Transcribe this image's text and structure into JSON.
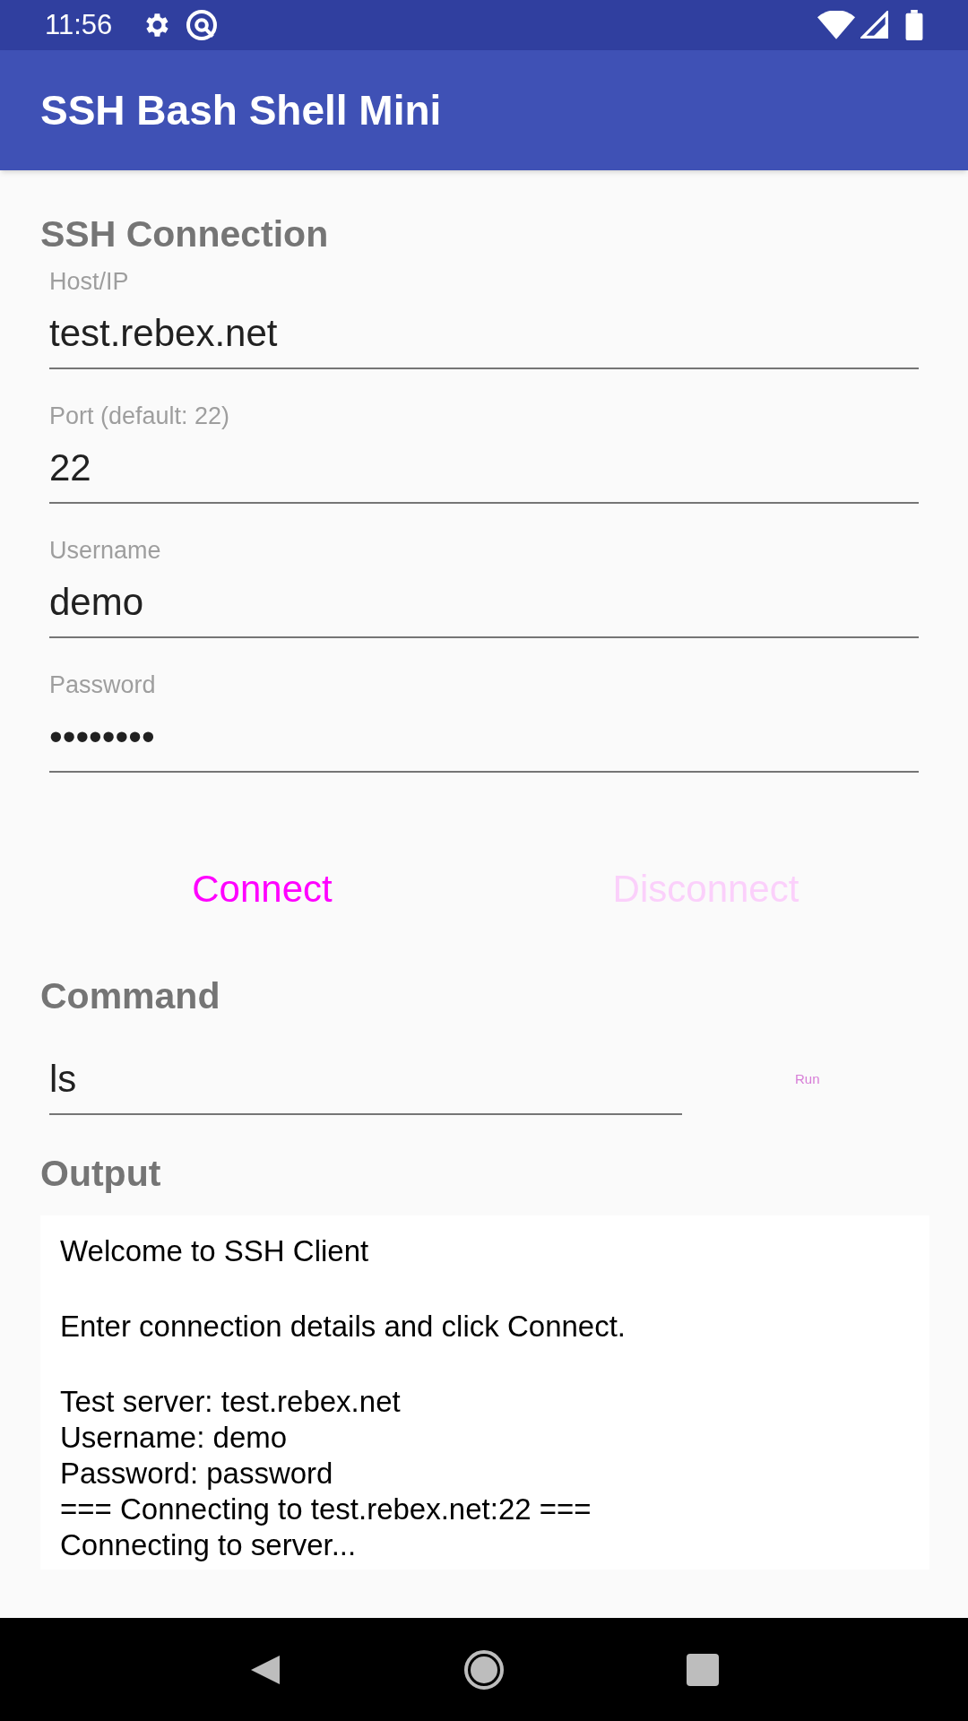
{
  "status_bar": {
    "time": "11:56"
  },
  "app_bar": {
    "title": "SSH Bash Shell Mini"
  },
  "connection": {
    "heading": "SSH Connection",
    "fields": [
      {
        "label": "Host/IP",
        "value": "test.rebex.net"
      },
      {
        "label": "Port (default: 22)",
        "value": "22"
      },
      {
        "label": "Username",
        "value": "demo"
      },
      {
        "label": "Password",
        "value": "••••••••"
      }
    ],
    "buttons": [
      {
        "label": "Connect",
        "disabled": false
      },
      {
        "label": "Disconnect",
        "disabled": true
      }
    ]
  },
  "command": {
    "heading": "Command",
    "value": "ls",
    "run_button": {
      "label": "Run",
      "disabled": true
    }
  },
  "output": {
    "heading": "Output",
    "blocks": [
      [
        "Welcome to SSH Client"
      ],
      [
        "Enter connection details and click Connect."
      ],
      [
        "Test server: test.rebex.net",
        "Username: demo",
        "Password: password",
        "=== Connecting to test.rebex.net:22 ===",
        "Connecting to server..."
      ]
    ]
  }
}
